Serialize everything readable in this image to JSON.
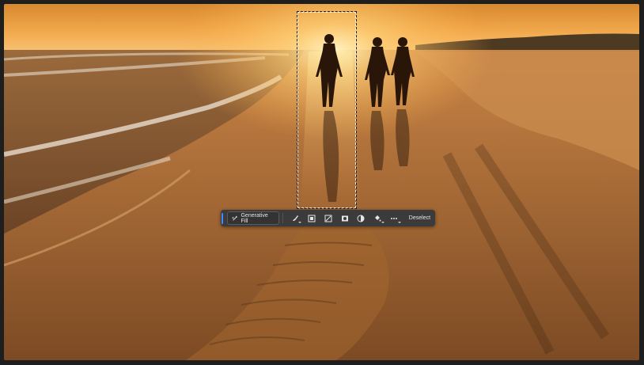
{
  "image": {
    "description_icon": "beach-sunset-photo"
  },
  "taskbar": {
    "generative_fill_label": "Generative Fill",
    "deselect_label": "Deselect",
    "icons": [
      "generative-fill-icon",
      "brush-icon",
      "selection-mask-icon",
      "transform-icon",
      "fill-mask-icon",
      "invert-icon",
      "paint-bucket-icon",
      "more-icon"
    ]
  },
  "colors": {
    "toolbar_bg": "#3b3b3b",
    "accent": "#3d8cff"
  }
}
